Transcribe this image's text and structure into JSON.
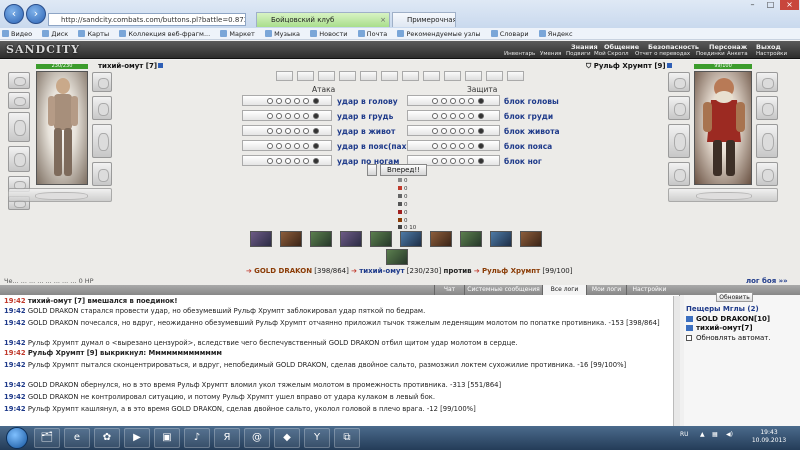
{
  "browser": {
    "address": "http://sandcity.combats.com/buttons.pl?battle=0.8739819286054",
    "tabs": [
      {
        "label": "Бойцовский клуб"
      },
      {
        "label": "Примерочная"
      }
    ],
    "bookmarks": [
      "Видео",
      "Диск",
      "Карты",
      "Коллекция веб-фрагм...",
      "Маркет",
      "Музыка",
      "Новости",
      "Почта",
      "Рекомендуемые узлы",
      "Словари",
      "Яндекс"
    ]
  },
  "game": {
    "logo": "SANDCITY",
    "menu_top": [
      "Знания",
      "Общение",
      "Безопасность",
      "Персонаж",
      "Выход"
    ],
    "menu_bottom": [
      "Инвентарь",
      "Умения",
      "Подвиги",
      "Мой Скролл",
      "Отчет о переводах",
      "Поединки",
      "Анкета",
      "Настройки"
    ],
    "player_left": {
      "name": "тихий-омут [7]",
      "hp": "230/230"
    },
    "player_right": {
      "name": "Рульф Хрумпт [9]",
      "hp": "99/100"
    },
    "attack_header": "Атака",
    "defense_header": "Защита",
    "attacks": [
      "удар в голову",
      "удар в грудь",
      "удар в живот",
      "удар в пояс(пах)",
      "удар по ногам"
    ],
    "blocks": [
      "блок головы",
      "блок груди",
      "блок живота",
      "блок пояса",
      "блок ног"
    ],
    "go_button": "Вперед!!",
    "stats": [
      "0",
      "0",
      "0",
      "0",
      "0",
      "0",
      "0"
    ],
    "stat_bottom": "0 10",
    "battle": {
      "left_name": "GOLD DRAKON",
      "left_hp": "[398/864]",
      "mid_name": "тихий-омут",
      "mid_hp": "[230/230]",
      "versus": "против",
      "right_name": "Рульф Хрумпт",
      "right_hp": "[99/100]"
    },
    "fights_link": "лог боя »»",
    "clipped_line": "Че... ... ... ... ... ... ... ... 0 НР"
  },
  "log_tabs": [
    "Чат",
    "Системные сообщения",
    "Все логи",
    "Мои логи",
    "Настройки"
  ],
  "log": [
    {
      "time": "19:42",
      "text": "тихий-омут [7] вмешался в поединок!"
    },
    {
      "time": "19:42",
      "text": "GOLD DRAKON старался провести удар, но обезумевший Рульф Хрумпт заблокировал удар пяткой по бедрам."
    },
    {
      "time": "19:42",
      "text": "GOLD DRAKON почесался, но вдруг, неожиданно обезумевший Рульф Хрумпт отчаянно приложил тычок тяжелым леденящим молотом по попатке противника. -153 [398/864]"
    },
    {
      "time": "19:42",
      "text": "Рульф Хрумпт думал о <вырезано цензурой>, вследствие чего беспечувственный GOLD DRAKON отбил щитом удар молотом в сердце."
    },
    {
      "time": "19:42",
      "text": "Рульф Хрумпт [9] выкрикнул: Ммммммммммммм"
    },
    {
      "time": "19:42",
      "text": "Рульф Хрумпт пытался сконцентрироваться, и вдруг, непобедимый GOLD DRAKON, сделав двойное сальто, размозжил локтем сухожилие противника. -16 [99/100%]"
    },
    {
      "time": "19:42",
      "text": "GOLD DRAKON обернулся, но в это время Рульф Хрумпт вломил укол тяжелым молотом в промежность противника. -313 [551/864]"
    },
    {
      "time": "19:42",
      "text": "GOLD DRAKON не контролировал ситуацию, и потому Рульф Хрумпт ушел вправо от удара кулаком в левый бок."
    },
    {
      "time": "19:42",
      "text": "Рульф Хрумпт кашлянул, а в это время GOLD DRAKON, сделав двойное сальто, уколол головой в плечо врага. -12 [99/100%]"
    }
  ],
  "right_panel": {
    "refresh_button": "Обновить",
    "location": "Пещеры Мглы (2)",
    "members": [
      "GOLD DRAKON[10]",
      "тихий-омут[7]"
    ],
    "auto_refresh": "Обновлять автомат."
  },
  "taskbar": {
    "lang": "RU",
    "time": "19:43",
    "date": "10.09.2013"
  }
}
